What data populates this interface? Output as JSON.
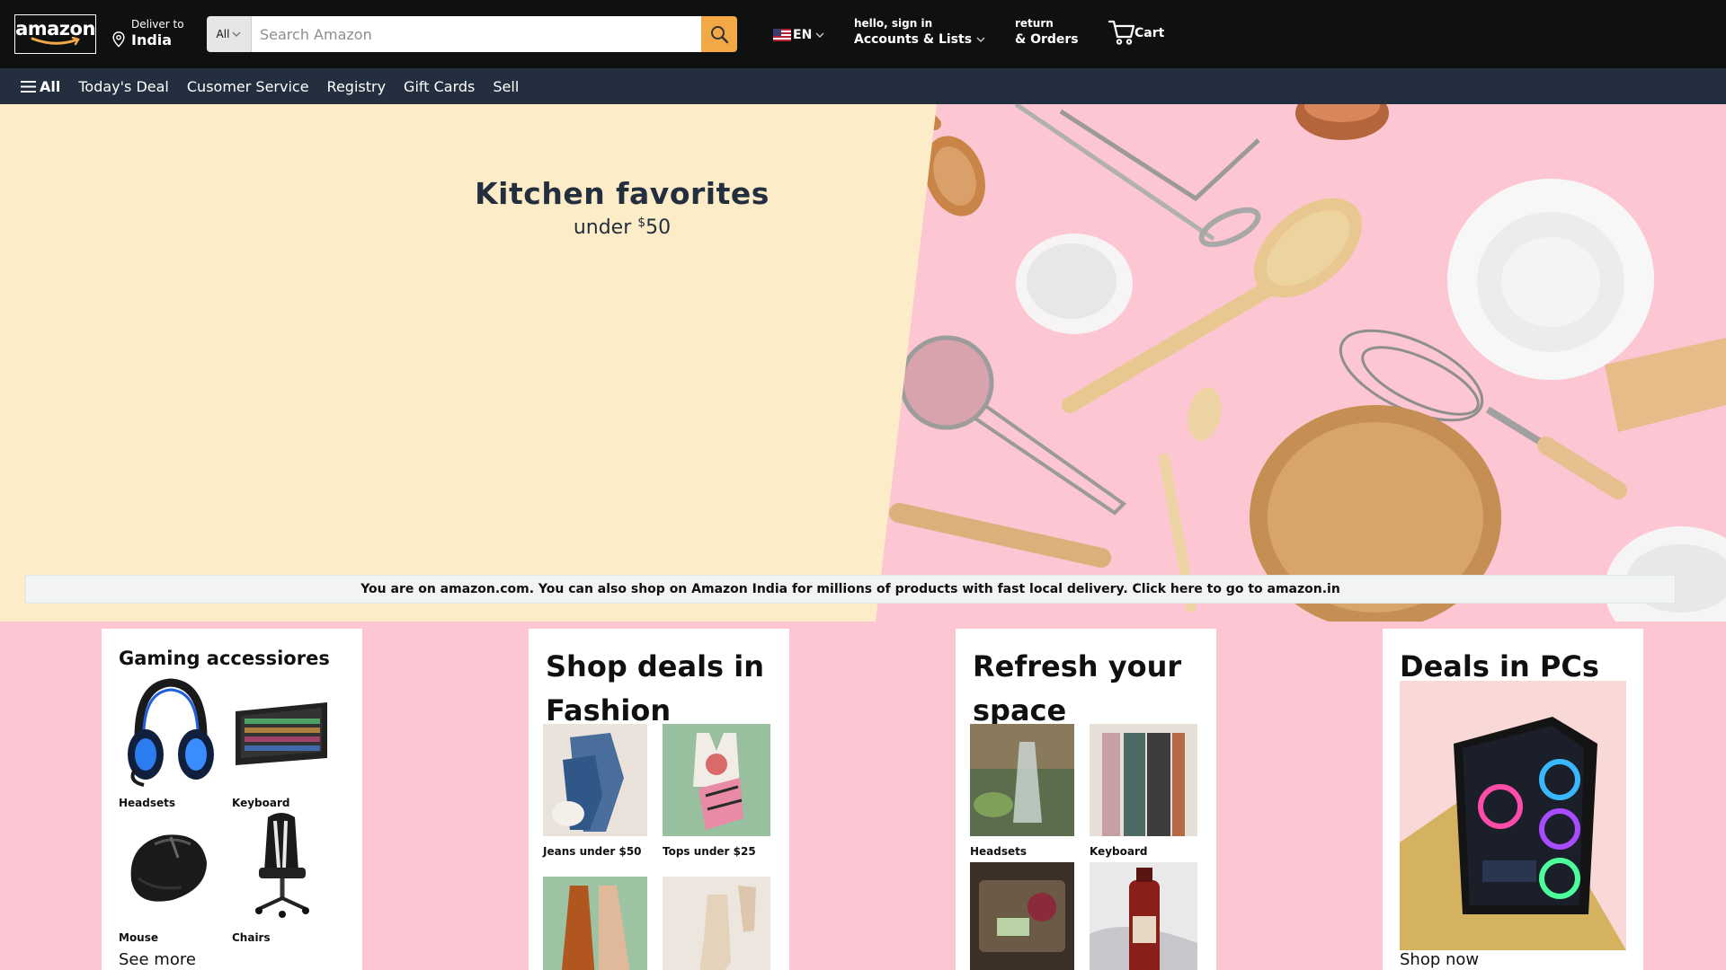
{
  "header": {
    "logo_text": "amazon",
    "deliver_label": "Deliver to",
    "deliver_location": "India",
    "search": {
      "category": "All",
      "placeholder": "Search Amazon"
    },
    "language": "EN",
    "account_greeting": "hello, sign in",
    "account_menu": "Accounts & Lists",
    "returns_line1": "return",
    "returns_line2": "& Orders",
    "cart_label": "Cart"
  },
  "nav": {
    "all_label": "All",
    "links": [
      "Today's Deal",
      "Cusomer Service",
      "Registry",
      "Gift Cards",
      "Sell"
    ]
  },
  "hero": {
    "title": "Kitchen favorites",
    "subtitle_prefix": "under ",
    "subtitle_currency": "$",
    "subtitle_amount": "50",
    "notice": "You are on amazon.com. You can also shop on Amazon India for millions of products with fast local delivery. Click here to go to amazon.in"
  },
  "cards": [
    {
      "title": "Gaming accessiores",
      "items": [
        "Headsets",
        "Keyboard",
        "Mouse",
        "Chairs"
      ],
      "link": "See more"
    },
    {
      "title": "Shop deals in Fashion",
      "items": [
        "Jeans under $50",
        "Tops under $25",
        "",
        ""
      ]
    },
    {
      "title": "Refresh your space",
      "items": [
        "Headsets",
        "Keyboard",
        "",
        ""
      ]
    },
    {
      "title": "Deals in PCs",
      "link": "Shop now"
    }
  ],
  "colors": {
    "header_bg": "#0f1111",
    "subnav_bg": "#232f3e",
    "search_button": "#f3a847",
    "hero_left": "#fdecc8",
    "hero_right": "#fcc6d3",
    "page_bg": "#fcc6d3"
  },
  "icons": [
    "location-pin-icon",
    "search-icon",
    "us-flag-icon",
    "chevron-down-icon",
    "cart-icon",
    "hamburger-menu-icon"
  ]
}
